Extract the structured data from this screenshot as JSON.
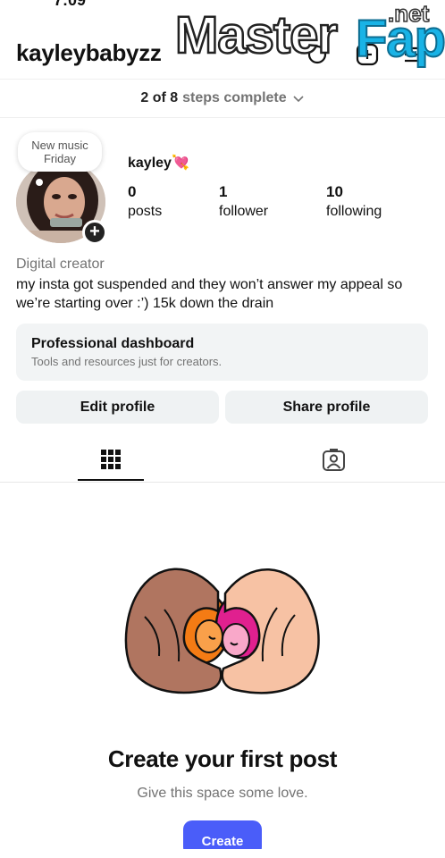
{
  "status_bar": {
    "time": "7:09"
  },
  "watermark": {
    "brand": "MasterFap",
    "master": "Master",
    "fap": "Fap",
    "net": ".net"
  },
  "header": {
    "username": "kayleybabyzz"
  },
  "steps": {
    "progress": "2 of 8",
    "label": "steps complete"
  },
  "note": {
    "line1": "New music",
    "line2": "Friday"
  },
  "profile": {
    "display_name": "kayley",
    "display_emoji": "💘",
    "stats": [
      {
        "value": "0",
        "label": "posts"
      },
      {
        "value": "1",
        "label": "follower"
      },
      {
        "value": "10",
        "label": "following"
      }
    ],
    "category": "Digital creator",
    "bio": "my insta got suspended and they won’t answer my appeal so we’re starting over :’) 15k down the drain"
  },
  "dashboard": {
    "title": "Professional dashboard",
    "subtitle": "Tools and resources just for creators."
  },
  "buttons": {
    "edit": "Edit profile",
    "share": "Share profile"
  },
  "tabs": [
    {
      "name": "grid",
      "icon": "grid-icon",
      "active": true
    },
    {
      "name": "tagged",
      "icon": "tagged-person-icon",
      "active": false
    }
  ],
  "empty_state": {
    "title": "Create your first post",
    "subtitle": "Give this space some love.",
    "button": "Create"
  },
  "colors": {
    "accent": "#4a5df9",
    "secondary_text": "#737373",
    "panel": "#f2f4f5"
  }
}
